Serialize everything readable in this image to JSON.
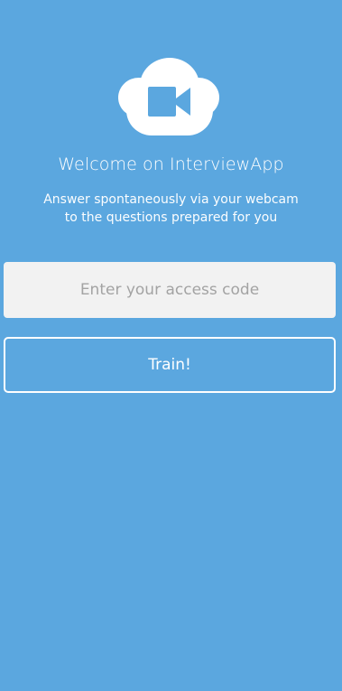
{
  "app": {
    "logo_icon": "cloud-video-camera-icon",
    "brand_color": "#5ba7df"
  },
  "header": {
    "title": "Welcome on InterviewApp",
    "subtitle_line_1": "Answer spontaneously via your webcam",
    "subtitle_line_2": "to the questions prepared for you"
  },
  "form": {
    "access_code_placeholder": "Enter your access code",
    "access_code_value": "",
    "train_label": "Train!"
  }
}
